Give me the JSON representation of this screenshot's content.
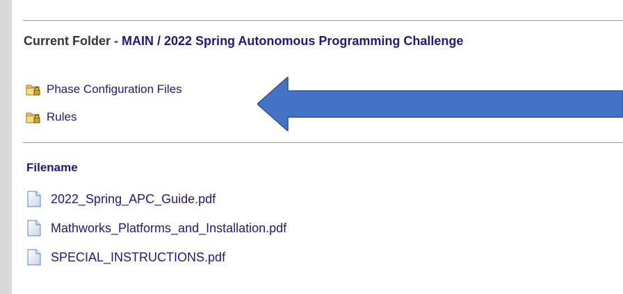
{
  "current_folder": {
    "prefix": "Current Folder - ",
    "path": "MAIN / 2022 Spring Autonomous Programming Challenge"
  },
  "folders": [
    {
      "label": "Phase Configuration Files",
      "icon": "locked-folder-icon"
    },
    {
      "label": "Rules",
      "icon": "locked-folder-icon"
    }
  ],
  "files": {
    "header": "Filename",
    "items": [
      {
        "label": "2022_Spring_APC_Guide.pdf",
        "icon": "document-icon"
      },
      {
        "label": "Mathworks_Platforms_and_Installation.pdf",
        "icon": "document-icon"
      },
      {
        "label": "SPECIAL_INSTRUCTIONS.pdf",
        "icon": "document-icon"
      }
    ]
  },
  "annotation": {
    "icon": "left-arrow-icon",
    "color": "#4472c4"
  },
  "colors": {
    "link": "#24177a",
    "label": "#333333",
    "background": "#ffffff",
    "frame": "#d9d9d9"
  }
}
